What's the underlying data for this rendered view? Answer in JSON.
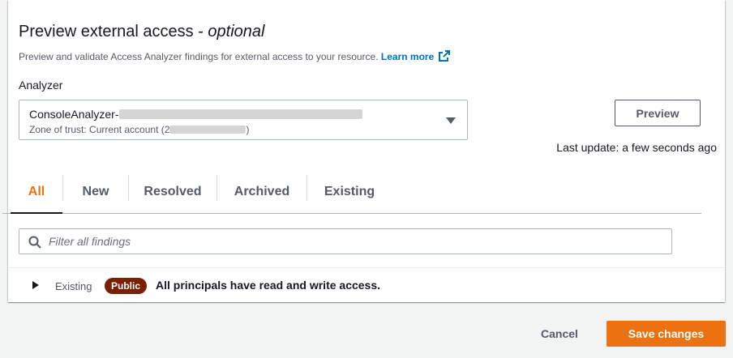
{
  "section": {
    "title": "Preview external access - ",
    "title_suffix": "optional",
    "description": "Preview and validate Access Analyzer findings for external access to your resource. ",
    "learn_more": "Learn more"
  },
  "analyzer": {
    "label": "Analyzer",
    "selected_name": "ConsoleAnalyzer-",
    "zone_prefix": "Zone of trust: Current account (",
    "zone_first_char": "2",
    "zone_suffix": ")",
    "redacted": true
  },
  "preview": {
    "button_label": "Preview",
    "last_update": "Last update: a few seconds ago"
  },
  "tabs": [
    {
      "label": "All",
      "active": true
    },
    {
      "label": "New",
      "active": false
    },
    {
      "label": "Resolved",
      "active": false
    },
    {
      "label": "Archived",
      "active": false
    },
    {
      "label": "Existing",
      "active": false
    }
  ],
  "search": {
    "placeholder": "Filter all findings",
    "value": ""
  },
  "findings": [
    {
      "status": "Existing",
      "badge": "Public",
      "text": "All principals have read and write access."
    }
  ],
  "footer": {
    "cancel_label": "Cancel",
    "save_label": "Save changes"
  },
  "colors": {
    "accent": "#ec7211",
    "link": "#0073bb",
    "badge_public": "#7a1e04",
    "background": "#f2f3f3"
  },
  "icons": {
    "external_link": "external-link-icon",
    "search": "search-icon",
    "dropdown": "caret-down-icon",
    "expand": "caret-right-icon"
  }
}
